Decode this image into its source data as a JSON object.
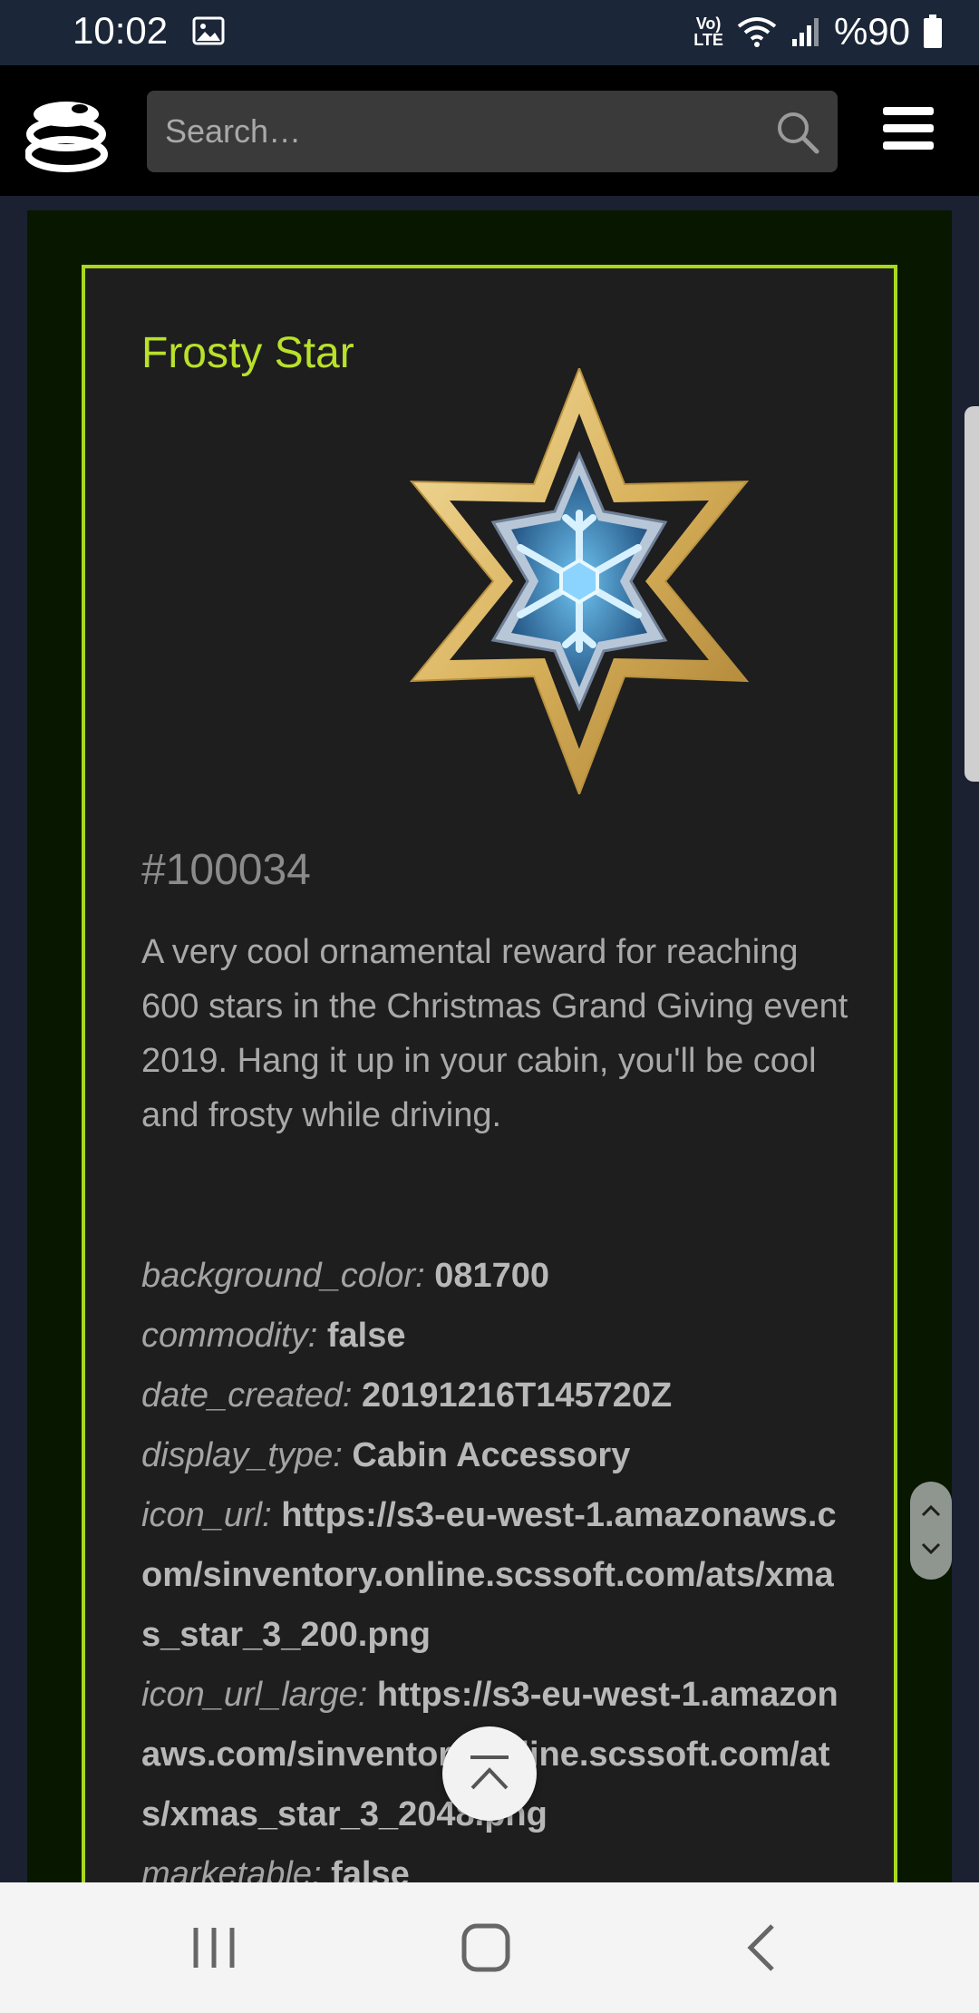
{
  "status_bar": {
    "time": "10:02",
    "network_badge_top": "Vo)",
    "network_badge_bottom": "LTE",
    "battery_text": "%90",
    "icons": [
      "gallery-icon",
      "wifi-icon",
      "signal-icon",
      "battery-icon"
    ]
  },
  "header": {
    "logo_icon": "stacked-coins-logo",
    "search_placeholder": "Search…",
    "search_icon": "search-icon",
    "menu_icon": "hamburger-menu-icon"
  },
  "item": {
    "title": "Frosty Star",
    "image_icon": "frosty-star-ornament",
    "id": "#100034",
    "description": "A very cool ornamental reward for reaching 600 stars in the Christmas Grand Giving event 2019. Hang it up in your cabin, you'll be cool and frosty while driving.",
    "properties": [
      {
        "key": "background_color:",
        "value": "081700"
      },
      {
        "key": "commodity:",
        "value": "false"
      },
      {
        "key": "date_created:",
        "value": "20191216T145720Z"
      },
      {
        "key": "display_type:",
        "value": "Cabin Accessory"
      },
      {
        "key": "icon_url:",
        "value": "https://s3-eu-west-1.amazonaws.com/sinventory.online.scssoft.com/ats/xmas_star_3_200.png"
      },
      {
        "key": "icon_url_large:",
        "value": "https://s3-eu-west-1.amazonaws.com/sinventory.online.scssoft.com/ats/xmas_star_3_2048.png"
      },
      {
        "key": "marketable:",
        "value": "false"
      }
    ]
  },
  "controls": {
    "fast_scroll_icons": [
      "chevron-up-icon",
      "chevron-down-icon"
    ],
    "back_to_top_icon": "back-to-top-icon"
  },
  "system_nav": {
    "icons": [
      "recent-apps-icon",
      "home-icon",
      "back-icon"
    ]
  },
  "colors": {
    "accent": "#a8d81e",
    "title": "#b9e12a",
    "panel_background": "#081700",
    "card_background": "#1e1e1e"
  }
}
